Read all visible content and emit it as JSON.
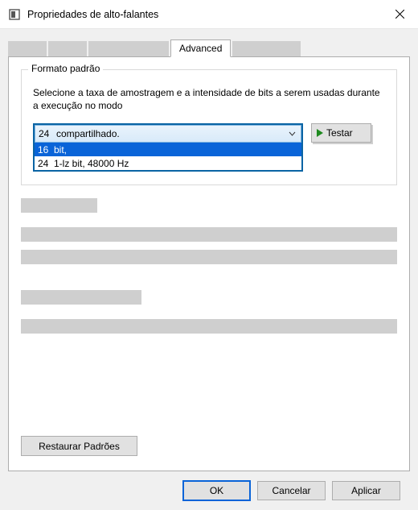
{
  "window": {
    "title": "Propriedades de alto-falantes"
  },
  "tabs": {
    "active_label": "Advanced"
  },
  "group1": {
    "legend": "Formato padrão",
    "description": "Selecione a taxa de amostragem e a intensidade de bits a serem usadas durante a execução no modo",
    "combo_prefix": "24",
    "combo_text": "compartilhado.",
    "options": [
      {
        "prefix": "16",
        "text": "bit,"
      },
      {
        "prefix": "24",
        "text": "1-lz bit, 48000 Hz"
      }
    ],
    "selected_index": 0
  },
  "buttons": {
    "test": "Testar",
    "restore": "Restaurar Padrões",
    "ok": "OK",
    "cancel": "Cancelar",
    "apply": "Aplicar"
  }
}
